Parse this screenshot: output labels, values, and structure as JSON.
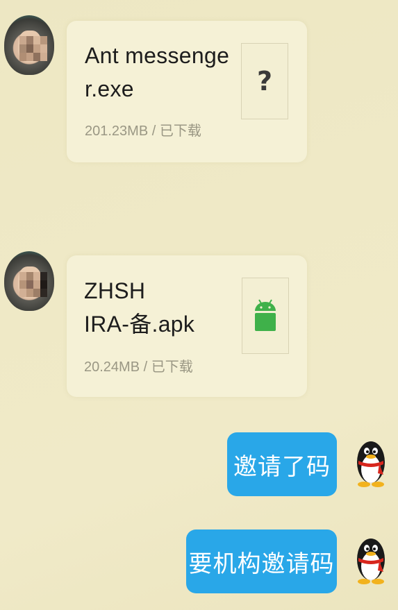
{
  "messages": [
    {
      "side": "left",
      "type": "file",
      "file_name_line1": "Ant messenge",
      "file_name_line2": "r.exe",
      "file_meta": "201.23MB / 已下载",
      "thumb_icon": "question-mark-icon",
      "thumb_text": "?"
    },
    {
      "side": "left",
      "type": "file",
      "file_name_line1": "ZHSH",
      "file_name_line2": "IRA-备.apk",
      "file_meta": "20.24MB / 已下载",
      "thumb_icon": "android-icon"
    },
    {
      "side": "right",
      "type": "text",
      "text": "邀请了码"
    },
    {
      "side": "right",
      "type": "text",
      "text": "要机构邀请码"
    }
  ],
  "colors": {
    "background": "#eee8c5",
    "outgoing_bubble": "#29a7e8",
    "android_green": "#3fb14a"
  }
}
